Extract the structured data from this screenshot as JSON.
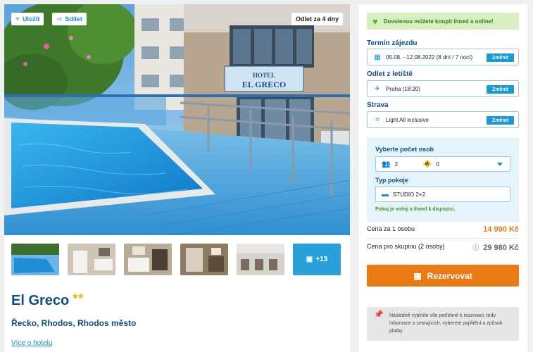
{
  "gallery": {
    "save_label": "Uložit",
    "share_label": "Sdílet",
    "departure_badge": "Odlet za 4 dny",
    "hotel_sign_line1": "HOTEL",
    "hotel_sign_line2": "EL GRECO",
    "more_photos": "+13"
  },
  "hotel": {
    "name": "El Greco",
    "stars": 2,
    "stars_text": "★★",
    "location": "Řecko, Rhodos, Rhodos město",
    "more_link": "Více o hotelu"
  },
  "booking": {
    "banner": "Dovolenou můžete koupit ihned a online!",
    "term": {
      "label": "Termín zájezdu",
      "value": "05.08. - 12.08.2022 (8 dní / 7 nocí)",
      "change": "Změnit"
    },
    "departure": {
      "label": "Odlet z letiště",
      "value": "Praha (18:20)",
      "change": "Změnit"
    },
    "board": {
      "label": "Strava",
      "value": "Light All inclusive",
      "change": "Změnit"
    },
    "persons": {
      "label": "Vyberte počet osob",
      "adults": "2",
      "children": "0"
    },
    "room": {
      "label": "Typ pokoje",
      "value": "STUDIO 2+2",
      "availability": "Pokoj je volný a ihned k dispozici."
    },
    "price_per_person_label": "Cena za 1 osobu",
    "price_per_person": "14 990 Kč",
    "price_group_label": "Cena pro skupinu (2 osoby)",
    "price_group": "29 980 Kč",
    "book_button": "Rezervovat",
    "note": "Následně vyplníte vše potřebné k rezervaci, tedy informace o cestujících, vyberete pojištění a způsob platby."
  },
  "colors": {
    "brand_blue": "#0d4f87",
    "accent_blue": "#1a9ad6",
    "orange": "#ea7a13",
    "green": "#5cae2a"
  }
}
